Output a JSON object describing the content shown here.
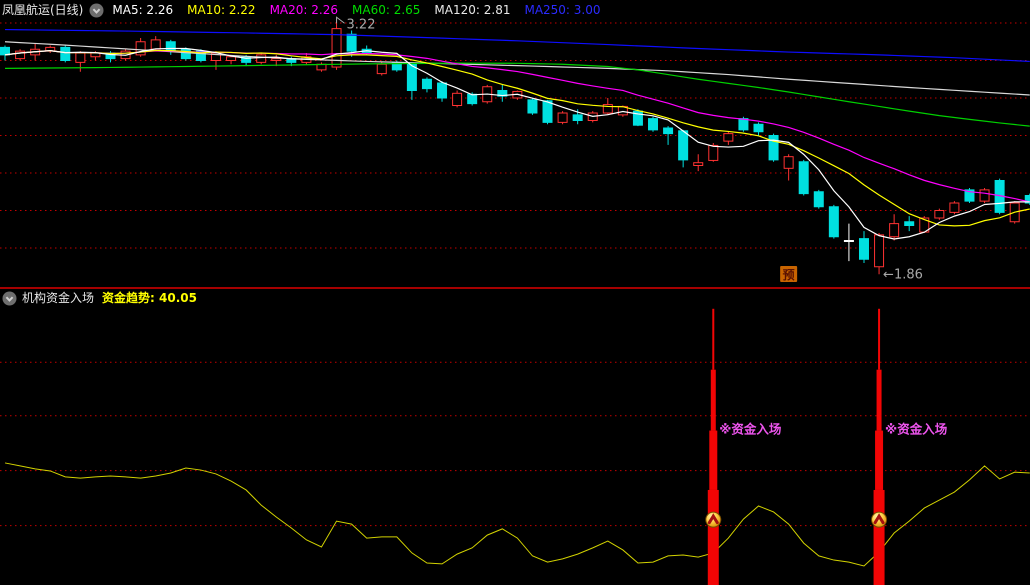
{
  "main_header": {
    "title": "凤凰航运(日线)",
    "ma_labels": [
      {
        "label": "MA5: 2.26",
        "color": "#ffffff"
      },
      {
        "label": "MA10: 2.22",
        "color": "#ffff00"
      },
      {
        "label": "MA20: 2.26",
        "color": "#ff00ff"
      },
      {
        "label": "MA60: 2.65",
        "color": "#00dd00"
      },
      {
        "label": "MA120: 2.81",
        "color": "#e8e8e8"
      },
      {
        "label": "MA250: 3.00",
        "color": "#2b2bff"
      }
    ]
  },
  "sub_header": {
    "title": "机构资金入场",
    "indicator_label": "资金趋势:",
    "indicator_value": "40.05",
    "value_color": "#ffff00"
  },
  "chart_data": [
    {
      "type": "candlestick",
      "title": "凤凰航运(日线)",
      "ylim": [
        1.795,
        3.25
      ],
      "grid_prices": [
        3.2,
        3.0,
        2.8,
        2.6,
        2.4,
        2.2,
        2.0
      ],
      "up_color": "#ff3232",
      "down_color": "#00e0e0",
      "doji_color": "#ffffff",
      "candles": [
        [
          3.07,
          3.08,
          3.0,
          3.03
        ],
        [
          3.01,
          3.06,
          3.0,
          3.05
        ],
        [
          3.03,
          3.09,
          3.0,
          3.06
        ],
        [
          3.05,
          3.08,
          3.04,
          3.07
        ],
        [
          3.07,
          3.08,
          2.99,
          3.0
        ],
        [
          2.99,
          3.05,
          2.94,
          3.04
        ],
        [
          3.02,
          3.05,
          3.0,
          3.04
        ],
        [
          3.04,
          3.05,
          2.99,
          3.01
        ],
        [
          3.01,
          3.06,
          3.0,
          3.05
        ],
        [
          3.03,
          3.12,
          3.02,
          3.1
        ],
        [
          3.06,
          3.13,
          3.05,
          3.11
        ],
        [
          3.1,
          3.11,
          3.03,
          3.05
        ],
        [
          3.06,
          3.07,
          3.0,
          3.01
        ],
        [
          3.05,
          3.06,
          2.99,
          3.0
        ],
        [
          3.0,
          3.05,
          2.95,
          3.04
        ],
        [
          3.0,
          3.03,
          2.98,
          3.02
        ],
        [
          3.02,
          3.03,
          2.97,
          2.99
        ],
        [
          2.99,
          3.04,
          2.98,
          3.03
        ],
        [
          3.0,
          3.03,
          2.97,
          3.01
        ],
        [
          3.01,
          3.02,
          2.97,
          2.99
        ],
        [
          2.99,
          3.04,
          2.98,
          3.02
        ],
        [
          2.95,
          2.99,
          2.94,
          2.98
        ],
        [
          2.965,
          3.22,
          2.95,
          3.17
        ],
        [
          3.14,
          3.16,
          3.02,
          3.05
        ],
        [
          3.06,
          3.08,
          3.03,
          3.04
        ],
        [
          2.93,
          2.99,
          2.92,
          2.98
        ],
        [
          2.99,
          3.0,
          2.94,
          2.95
        ],
        [
          2.98,
          2.99,
          2.79,
          2.84
        ],
        [
          2.9,
          2.91,
          2.83,
          2.85
        ],
        [
          2.88,
          2.89,
          2.78,
          2.8
        ],
        [
          2.76,
          2.84,
          2.75,
          2.825
        ],
        [
          2.82,
          2.83,
          2.76,
          2.77
        ],
        [
          2.78,
          2.87,
          2.77,
          2.86
        ],
        [
          2.84,
          2.87,
          2.78,
          2.81
        ],
        [
          2.8,
          2.84,
          2.79,
          2.835
        ],
        [
          2.79,
          2.8,
          2.71,
          2.72
        ],
        [
          2.785,
          2.79,
          2.66,
          2.67
        ],
        [
          2.67,
          2.73,
          2.66,
          2.72
        ],
        [
          2.71,
          2.74,
          2.66,
          2.68
        ],
        [
          2.68,
          2.73,
          2.67,
          2.72
        ],
        [
          2.72,
          2.8,
          2.71,
          2.765
        ],
        [
          2.71,
          2.76,
          2.7,
          2.755
        ],
        [
          2.73,
          2.74,
          2.65,
          2.655
        ],
        [
          2.69,
          2.7,
          2.62,
          2.63
        ],
        [
          2.64,
          2.65,
          2.55,
          2.61
        ],
        [
          2.625,
          2.63,
          2.43,
          2.47
        ],
        [
          2.44,
          2.5,
          2.41,
          2.455
        ],
        [
          2.467,
          2.56,
          2.46,
          2.547
        ],
        [
          2.57,
          2.62,
          2.55,
          2.61
        ],
        [
          2.69,
          2.7,
          2.62,
          2.63
        ],
        [
          2.66,
          2.67,
          2.6,
          2.62
        ],
        [
          2.6,
          2.61,
          2.46,
          2.47
        ],
        [
          2.425,
          2.5,
          2.36,
          2.487
        ],
        [
          2.46,
          2.47,
          2.28,
          2.29
        ],
        [
          2.3,
          2.31,
          2.21,
          2.22
        ],
        [
          2.22,
          2.23,
          2.05,
          2.06
        ],
        [
          2.035,
          2.13,
          1.93,
          2.04
        ],
        [
          2.05,
          2.09,
          1.92,
          1.94
        ],
        [
          1.9,
          2.08,
          1.86,
          2.07
        ],
        [
          2.06,
          2.18,
          2.04,
          2.13
        ],
        [
          2.14,
          2.17,
          2.09,
          2.12
        ],
        [
          2.085,
          2.17,
          2.08,
          2.16
        ],
        [
          2.16,
          2.21,
          2.15,
          2.2
        ],
        [
          2.19,
          2.25,
          2.18,
          2.24
        ],
        [
          2.31,
          2.32,
          2.24,
          2.25
        ],
        [
          2.25,
          2.32,
          2.24,
          2.31
        ],
        [
          2.36,
          2.37,
          2.18,
          2.19
        ],
        [
          2.14,
          2.25,
          2.13,
          2.24
        ],
        [
          2.28,
          2.29,
          2.23,
          2.24
        ]
      ],
      "ma_short": [
        {
          "name": "MA5",
          "window": 5,
          "color": "#ffffff"
        },
        {
          "name": "MA10",
          "window": 10,
          "color": "#ffff00"
        },
        {
          "name": "MA20",
          "window": 20,
          "color": "#ff00ff"
        }
      ],
      "ma_long": [
        {
          "name": "MA60",
          "color": "#00d000",
          "points": [
            [
              0,
              2.958
            ],
            [
              6,
              2.962
            ],
            [
              12,
              2.968
            ],
            [
              18,
              2.975
            ],
            [
              24,
              2.982
            ],
            [
              30,
              2.986
            ],
            [
              34,
              2.985
            ],
            [
              37,
              2.98
            ],
            [
              40,
              2.968
            ],
            [
              42,
              2.95
            ],
            [
              44,
              2.925
            ],
            [
              46,
              2.9
            ],
            [
              48,
              2.878
            ],
            [
              50,
              2.856
            ],
            [
              52,
              2.832
            ],
            [
              54,
              2.806
            ],
            [
              56,
              2.78
            ],
            [
              58,
              2.755
            ],
            [
              60,
              2.73
            ],
            [
              62,
              2.706
            ],
            [
              64,
              2.686
            ],
            [
              66,
              2.667
            ],
            [
              68,
              2.65
            ]
          ]
        },
        {
          "name": "MA120",
          "color": "#d9d9d9",
          "points": [
            [
              0,
              3.1
            ],
            [
              4,
              3.082
            ],
            [
              8,
              3.062
            ],
            [
              12,
              3.042
            ],
            [
              16,
              3.022
            ],
            [
              20,
              3.006
            ],
            [
              24,
              2.995
            ],
            [
              28,
              2.986
            ],
            [
              32,
              2.977
            ],
            [
              36,
              2.968
            ],
            [
              40,
              2.958
            ],
            [
              44,
              2.945
            ],
            [
              48,
              2.925
            ],
            [
              52,
              2.9
            ],
            [
              56,
              2.878
            ],
            [
              60,
              2.856
            ],
            [
              64,
              2.836
            ],
            [
              68,
              2.816
            ]
          ]
        },
        {
          "name": "MA250",
          "color": "#0d0dff",
          "points": [
            [
              0,
              3.165
            ],
            [
              8,
              3.157
            ],
            [
              16,
              3.147
            ],
            [
              22,
              3.138
            ],
            [
              28,
              3.122
            ],
            [
              34,
              3.105
            ],
            [
              40,
              3.085
            ],
            [
              46,
              3.064
            ],
            [
              52,
              3.045
            ],
            [
              58,
              3.03
            ],
            [
              63,
              3.015
            ],
            [
              68,
              2.995
            ]
          ]
        }
      ],
      "annotations": [
        {
          "text": "3.22",
          "index": 22,
          "anchor": "high",
          "color": "#a8a8a8"
        },
        {
          "text": "←1.86",
          "index": 58,
          "anchor": "low",
          "color": "#a8a8a8"
        }
      ],
      "flag": {
        "text": "预",
        "index": 52,
        "bg": "#c86400",
        "fg": "#581000"
      }
    },
    {
      "type": "line",
      "title": "机构资金入场",
      "series_name": "资金趋势",
      "current_value": 40.05,
      "scale": [
        0,
        100
      ],
      "grid_values": [
        75,
        57,
        38.5,
        20
      ],
      "line_color": "#d2d200",
      "values": [
        41.1,
        40.1,
        39.1,
        38.4,
        36.4,
        36.0,
        36.4,
        36.7,
        36.4,
        36.0,
        36.7,
        37.7,
        39.4,
        38.7,
        37.4,
        35.0,
        32.0,
        26.9,
        22.9,
        19.2,
        15.2,
        12.8,
        21.5,
        20.5,
        15.8,
        16.2,
        16.2,
        10.8,
        7.4,
        7.1,
        10.4,
        12.5,
        16.8,
        18.9,
        15.8,
        9.8,
        7.7,
        8.8,
        10.4,
        12.5,
        14.8,
        11.8,
        7.4,
        7.7,
        9.8,
        10.1,
        9.4,
        10.8,
        15.8,
        22.2,
        26.6,
        24.6,
        20.5,
        14.1,
        9.8,
        8.4,
        7.7,
        6.4,
        11.1,
        17.5,
        21.5,
        25.9,
        28.6,
        31.3,
        35.4,
        40.1,
        35.7,
        38.0,
        37.7
      ],
      "signals": {
        "indices": [
          47,
          58
        ],
        "label": "※资金入场",
        "label_color": "#ee55ee",
        "label_value": 51,
        "bar_color": "#f20505",
        "bar_profile": [
          [
            93,
            72.5,
            2
          ],
          [
            72.5,
            52,
            5
          ],
          [
            52,
            32,
            8
          ],
          [
            32,
            0,
            11
          ]
        ],
        "marker": "gold-circle-up-arrow",
        "marker_value": 22
      }
    }
  ]
}
